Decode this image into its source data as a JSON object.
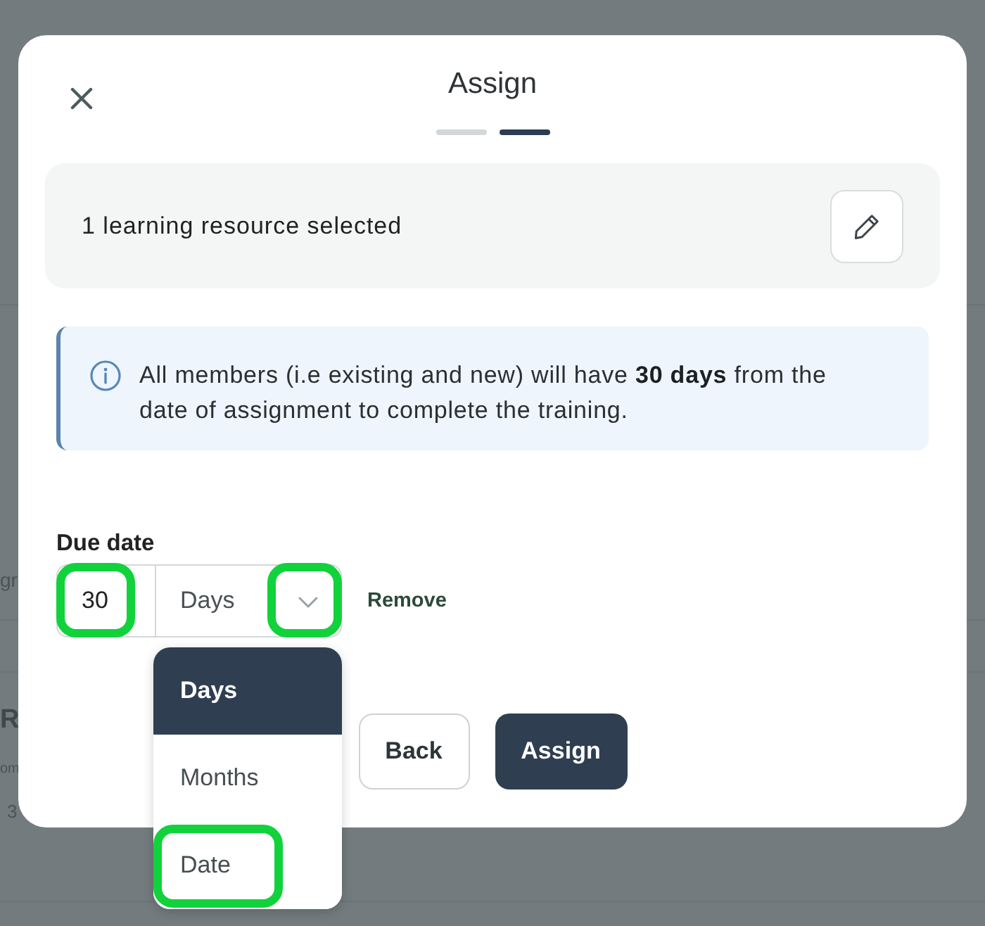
{
  "background_page": {
    "rows": [
      {
        "cells": [
          {
            "kind": "label",
            "text": "gr"
          }
        ]
      },
      {
        "cells": [
          {
            "kind": "title",
            "text": "R"
          },
          {
            "kind": "subtitle",
            "text": "om"
          },
          {
            "kind": "meta",
            "text": "3"
          }
        ]
      }
    ]
  },
  "dialog": {
    "title": "Assign",
    "steps": [
      {
        "selected": false
      },
      {
        "selected": true
      }
    ],
    "selection_summary": "1 learning resource selected",
    "info_note": "All members (i.e existing and new) will have **30 days** from the date of assignment to complete the training.",
    "due_date": {
      "label": "Due date",
      "amount": {
        "value": "30",
        "highlighted": true
      },
      "unit": {
        "value": "Days",
        "highlighted": true
      },
      "remove_link": "Remove"
    },
    "unit_menu": {
      "options": [
        {
          "label": "Days",
          "selected": true,
          "highlighted": false
        },
        {
          "label": "Months",
          "selected": false,
          "highlighted": false
        },
        {
          "label": "Date",
          "selected": false,
          "highlighted": true
        }
      ]
    },
    "buttons": [
      {
        "label": "Back",
        "kind": "secondary"
      },
      {
        "label": "Assign",
        "kind": "primary"
      }
    ]
  }
}
